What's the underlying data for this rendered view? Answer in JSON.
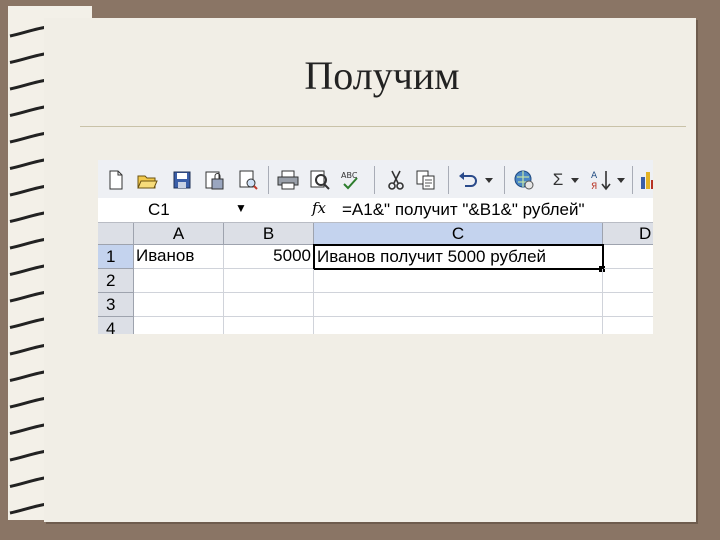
{
  "slide": {
    "title": "Получим"
  },
  "excel": {
    "toolbar": {
      "icons": [
        "new-icon",
        "open-icon",
        "save-icon",
        "permissions-icon",
        "print-preview-icon",
        "print-icon",
        "preview-icon",
        "spelling-icon",
        "cut-icon",
        "copy-icon",
        "undo-icon",
        "hyperlink-icon",
        "autosum-icon",
        "sort-icon",
        "chart-icon"
      ],
      "autosum_symbol": "Σ"
    },
    "name_box": "C1",
    "fx_label": "fx",
    "formula": "=A1&\" получит \"&B1&\" рублей\"",
    "columns": [
      "A",
      "B",
      "C",
      "D"
    ],
    "rows": [
      "1",
      "2",
      "3",
      "4"
    ],
    "cells": {
      "A1": "Иванов",
      "B1": "5000",
      "C1": "Иванов получит 5000 рублей"
    },
    "active_cell": "C1"
  }
}
